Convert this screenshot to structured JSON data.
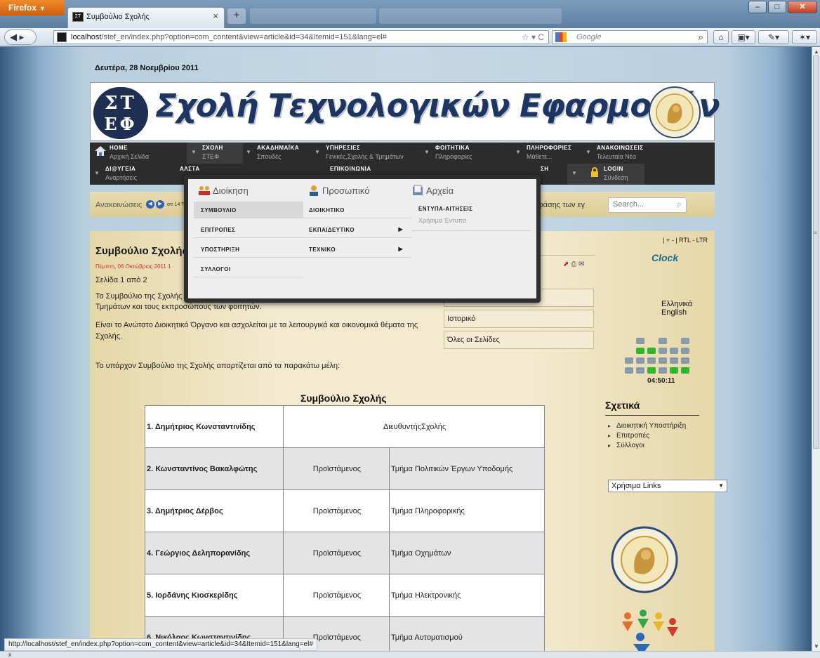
{
  "browser": {
    "menu_button": "Firefox",
    "tab_title": "Συμβούλιο Σχολής",
    "tab_close": "×",
    "new_tab": "+",
    "url_host": "localhost",
    "url_path": "/stef_en/index.php?option=com_content&view=article&id=34&Itemid=151&lang=el#",
    "search_engine_placeholder": "Google",
    "status_url": "http://localhost/stef_en/index.php?option=com_content&view=article&id=34&Itemid=151&lang=el#",
    "bottom_close": "x"
  },
  "page": {
    "date": "Δευτέρα, 28 Νοεμβρίου 2011",
    "banner_title": "Σχολή Τεχνολογικών Εφαρμογών",
    "logo_top": "ΣΤ",
    "logo_bottom": "ΕΦ"
  },
  "main_menu": [
    {
      "title": "HOME",
      "subtitle": "Αρχική Σελίδα"
    },
    {
      "title": "ΣΧΟΛΗ",
      "subtitle": "ΣΤΕΦ"
    },
    {
      "title": "ΑΚΑΔΗΜΑΪΚΑ",
      "subtitle": "Σπουδές"
    },
    {
      "title": "ΥΠΗΡΕΣΙΕΣ",
      "subtitle": "Γενικές,Σχολής & Τμημάτων"
    },
    {
      "title": "ΦΟΙΤΗΤΙΚΑ",
      "subtitle": "Πληροφορίες"
    },
    {
      "title": "ΠΛΗΡΟΦΟΡΙΕΣ",
      "subtitle": "Μάθετε..."
    },
    {
      "title": "ΑΝΑΚΟΙΝΩΣΕΙΣ",
      "subtitle": "Τελευταία Νέα"
    },
    {
      "title": "ΔΙ@ΥΓΕΙΑ",
      "subtitle": "Αναρτήσεις"
    },
    {
      "title": "ΑΛΣΤΑ",
      "subtitle": ""
    },
    {
      "title": "ΕΠΙΚΟΙΝΩΝΙΑ",
      "subtitle": ""
    },
    {
      "title": "ΣΗ",
      "subtitle": ""
    },
    {
      "title": "LOGIN",
      "subtitle": "Σύνδεση"
    }
  ],
  "ticker": {
    "label": "Ανακοινώσεις",
    "fragment": "στι 14 Τ",
    "tail": "Α' φάσης των εγ",
    "search_placeholder": "Search..."
  },
  "dropdown": {
    "col1_title": "Διοίκηση",
    "col2_title": "Προσωπικό",
    "col3_title": "Αρχεία",
    "col1_items": [
      "ΣΥΜΒΟΥΛΙΟ",
      "ΕΠΙΤΡΟΠΕΣ",
      "ΥΠΟΣΤΗΡΙΞΗ",
      "ΣΥΛΛΟΓΟΙ"
    ],
    "col2_items": [
      "ΔΙΟΙΚΗΤΙΚΟ",
      "ΕΚΠΑΙΔΕΥΤΙΚΟ",
      "ΤΕΧΝΙΚΟ"
    ],
    "col3_item": "ΕΝΤΥΠΑ-ΑΙΤΗΣΕΙΣ",
    "col3_sub": "Χρήσιμα Έντυπα"
  },
  "article": {
    "title": "Συμβούλιο Σχολής",
    "meta": "Πέμπτη, 06 Οκτώβριος 2011 1",
    "page_of": "Σελίδα 1 από 2",
    "p1_start": "Το Συμβούλιο της Σχολής",
    "p1_end": "Τμημάτων και τους εκπροσώπους των φοιτητών.",
    "p2": "Είναι το Ανώτατο Διοικητικό Όργανο και ασχολείται με τα λειτουργικά και οικονομικά θέματα της Σχολής.",
    "p3": "Το υπάρχον Συμβούλιο της Σχολής απαρτίζεται από τα παρακάτω μέλη:",
    "toc": [
      "",
      "Ιστορικό",
      "Όλες οι Σελίδες"
    ],
    "table_title": "Συμβούλιο Σχολής",
    "members": [
      {
        "name": "1. Δημήτριος Κωνσταντινίδης",
        "role": "ΔιευθυντήςΣχολής",
        "dept": ""
      },
      {
        "name": "2. Κωνσταντίνος Βακαλφώτης",
        "role": "Προϊστάμενος",
        "dept": "Τμήμα Πολιτικών Έργων Υποδομής"
      },
      {
        "name": "3. Δημήτριος Δέρβος",
        "role": "Προϊστάμενος",
        "dept": "Τμήμα Πληροφορικής"
      },
      {
        "name": "4. Γεώργιος Δεληπορανίδης",
        "role": "Προϊστάμενος",
        "dept": "Τμήμα Οχημάτων"
      },
      {
        "name": "5. Ιορδάνης Κιοσκερίδης",
        "role": "Προϊστάμενος",
        "dept": "Τμήμα Ηλεκτρονικής"
      },
      {
        "name": "6. Νικόλαος Κωνσταντινίδης",
        "role": "Προϊστάμενος",
        "dept": "Τμήμα Αυτοματισμού"
      }
    ]
  },
  "sidebar": {
    "size_controls": "| +  -  | RTL - LTR",
    "clock_title": "Clock",
    "languages": "Ελληνικά English",
    "clock_time": "04:50:11",
    "related_title": "Σχετικά",
    "related_links": [
      "Διοικητική Υποστήριξη",
      "Επιτροπές",
      "Σύλλογοι"
    ],
    "useful_links": "Χρήσιμα Links"
  },
  "colors": {
    "menu_bg": "#2c2c2c",
    "banner_text": "#1f3561",
    "led_on": "#2db52d",
    "led_off": "#8a9aa8"
  }
}
